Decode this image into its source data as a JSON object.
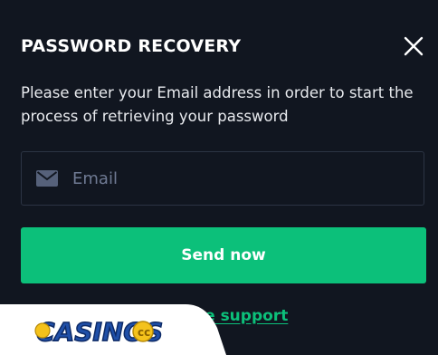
{
  "modal": {
    "title": "PASSWORD RECOVERY",
    "description": "Please enter your Email address in order to start the process of retrieving your password",
    "close_icon": "close-icon",
    "email": {
      "icon": "envelope-icon",
      "placeholder": "Email",
      "value": ""
    },
    "send_label": "Send now",
    "support_link": "Contact us e support"
  },
  "watermark": {
    "text": "CASINOS.cc"
  },
  "colors": {
    "background": "#111620",
    "accent": "#0cc07a",
    "field_border": "#2c3444",
    "placeholder": "#6f7a93"
  }
}
